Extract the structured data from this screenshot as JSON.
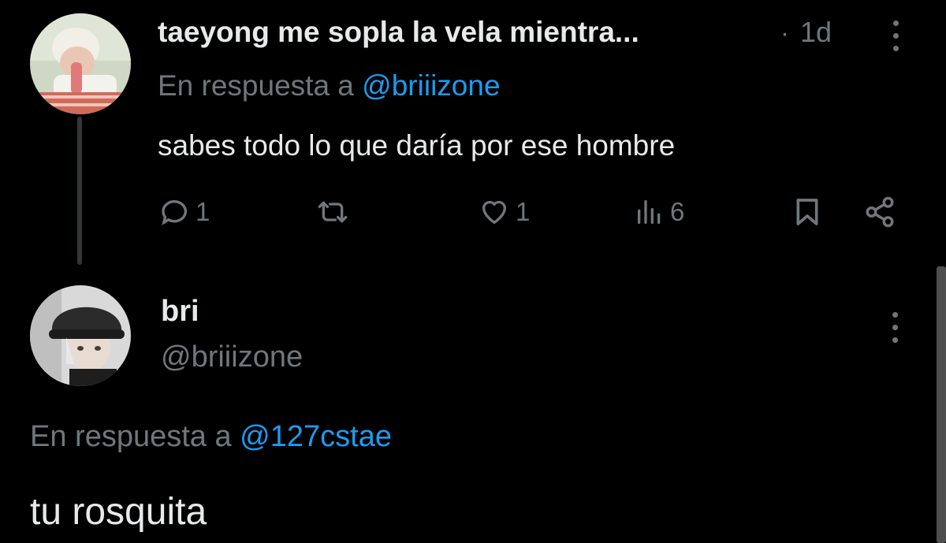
{
  "reply": {
    "author_name": "taeyong me sopla la vela mientra...",
    "separator": "·",
    "time": "1d",
    "replying_prefix": "En respuesta a",
    "replying_handle": "@briiizone",
    "text": "sabes todo lo que daría por ese hombre",
    "actions": {
      "comments": "1",
      "retweets": "",
      "likes": "1",
      "views": "6"
    }
  },
  "main_tweet": {
    "author_name": "bri",
    "author_handle": "@briiizone",
    "replying_prefix": "En respuesta a",
    "replying_handle": "@127cstae",
    "text": "tu rosquita"
  },
  "colors": {
    "background": "#000000",
    "text": "#e7e9ea",
    "muted": "#71767b",
    "accent": "#1d9bf0"
  },
  "icons": [
    "more-icon",
    "comment-icon",
    "retweet-icon",
    "like-icon",
    "views-icon",
    "bookmark-icon",
    "share-icon"
  ]
}
